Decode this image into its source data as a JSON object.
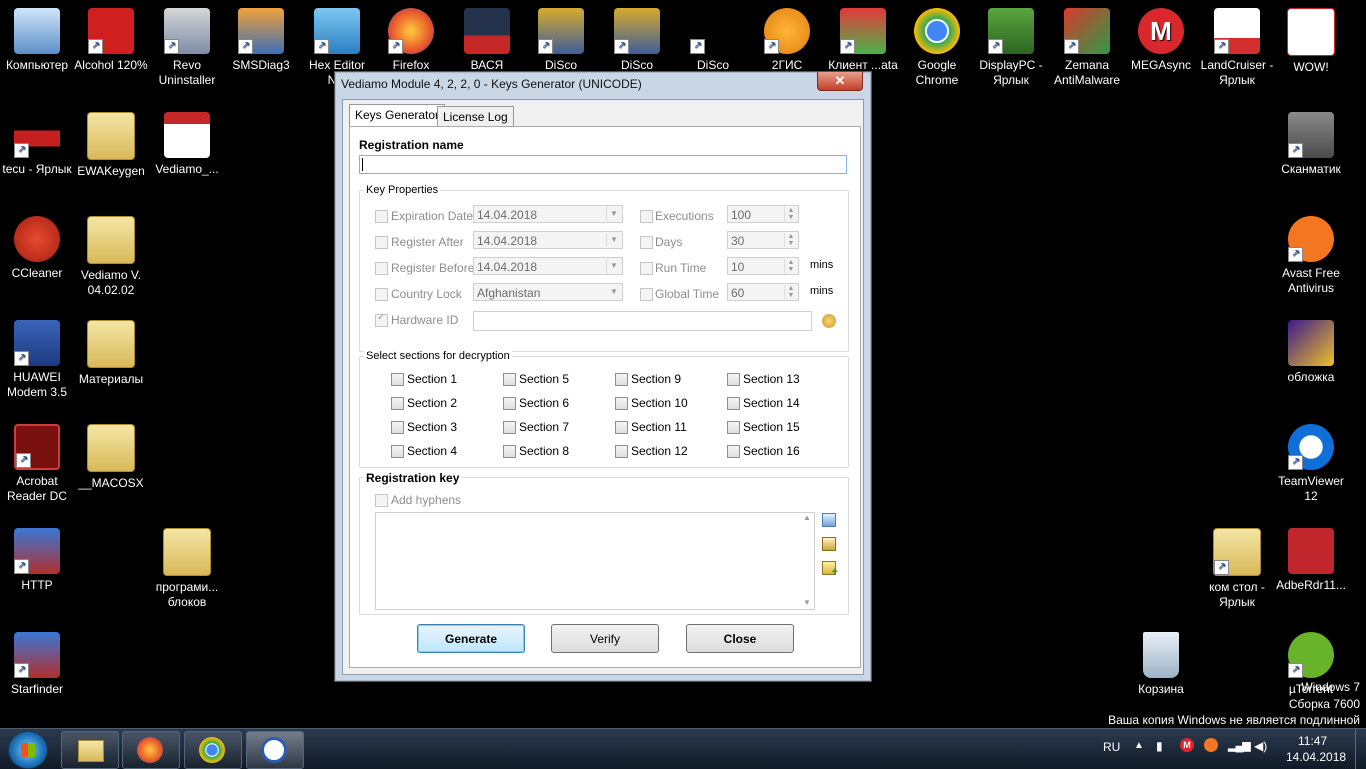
{
  "desktop": {
    "icons": [
      {
        "label": "Компьютер"
      },
      {
        "label": "Alcohol 120%"
      },
      {
        "label": "Revo Uninstaller"
      },
      {
        "label": "SMSDiag3"
      },
      {
        "label": "Hex Editor N..."
      },
      {
        "label": "Firefox"
      },
      {
        "label": "ВАСЯ"
      },
      {
        "label": "DiSco"
      },
      {
        "label": "DiSco"
      },
      {
        "label": "DiSco Express"
      },
      {
        "label": "2ГИС"
      },
      {
        "label": "Клиент ...ata"
      },
      {
        "label": "Google Chrome"
      },
      {
        "label": "DisplayPC - Ярлык"
      },
      {
        "label": "Zemana AntiMalware"
      },
      {
        "label": "MEGAsync"
      },
      {
        "label": "LandCruiser - Ярлык"
      },
      {
        "label": "WOW!"
      },
      {
        "label": "tecu - Ярлык"
      },
      {
        "label": "EWAKeygen"
      },
      {
        "label": "Vediamo_..."
      },
      {
        "label": "Сканматик"
      },
      {
        "label": "CCleaner"
      },
      {
        "label": "Vediamo V. 04.02.02"
      },
      {
        "label": "Avast Free Antivirus"
      },
      {
        "label": "HUAWEI Modem 3.5"
      },
      {
        "label": "Материалы"
      },
      {
        "label": "обложка"
      },
      {
        "label": "Acrobat Reader DC"
      },
      {
        "label": "__MACOSX"
      },
      {
        "label": "TeamViewer 12"
      },
      {
        "label": "HTTP"
      },
      {
        "label": "програми... блоков"
      },
      {
        "label": "ком стол - Ярлык"
      },
      {
        "label": "AdbeRdr11..."
      },
      {
        "label": "Starfinder"
      },
      {
        "label": "Корзина"
      },
      {
        "label": "µTorrent"
      }
    ],
    "watermark": [
      "Windows 7",
      "Сборка 7600",
      "Ваша копия Windows не является подлинной"
    ]
  },
  "window": {
    "title": "Vediamo Module 4, 2, 2, 0 - Keys Generator (UNICODE)",
    "close": "✕",
    "tabs": [
      "Keys Generator",
      "License Log"
    ],
    "registration_name_label": "Registration name",
    "registration_name_value": "",
    "key_properties_label": "Key Properties",
    "props": {
      "expiration_date": {
        "label": "Expiration Date",
        "value": "14.04.2018"
      },
      "register_after": {
        "label": "Register After",
        "value": "14.04.2018"
      },
      "register_before": {
        "label": "Register Before",
        "value": "14.04.2018"
      },
      "country_lock": {
        "label": "Country Lock",
        "value": "Afghanistan"
      },
      "hardware_id": {
        "label": "Hardware ID",
        "value": ""
      },
      "executions": {
        "label": "Executions",
        "value": "100"
      },
      "days": {
        "label": "Days",
        "value": "30"
      },
      "run_time": {
        "label": "Run Time",
        "value": "10",
        "unit": "mins"
      },
      "global_time": {
        "label": "Global Time",
        "value": "60",
        "unit": "mins"
      }
    },
    "sections_label": "Select sections for decryption",
    "sections": [
      "Section 1",
      "Section 2",
      "Section 3",
      "Section 4",
      "Section 5",
      "Section 6",
      "Section 7",
      "Section 8",
      "Section 9",
      "Section 10",
      "Section 11",
      "Section 12",
      "Section 13",
      "Section 14",
      "Section 15",
      "Section 16"
    ],
    "registration_key_label": "Registration key",
    "add_hyphens": "Add hyphens",
    "buttons": {
      "generate": "Generate",
      "verify": "Verify",
      "close": "Close"
    }
  },
  "taskbar": {
    "lang": "RU",
    "time": "11:47",
    "date": "14.04.2018"
  }
}
